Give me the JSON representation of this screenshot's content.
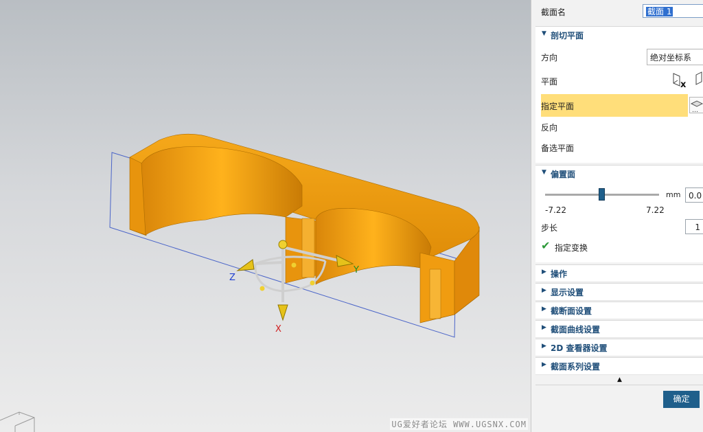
{
  "viewport": {
    "axis_labels": {
      "x": "X",
      "y": "Y",
      "z": "Z"
    }
  },
  "panel": {
    "section_name_label": "截面名",
    "section_name_value": "截面 1",
    "cut_plane": {
      "title": "剖切平面",
      "direction_label": "方向",
      "direction_value": "绝对坐标系",
      "plane_label": "平面",
      "specify_plane_label": "指定平面",
      "reverse_label": "反向",
      "alternate_plane_label": "备选平面"
    },
    "offset": {
      "title": "偏置面",
      "slider_min": "-7.22",
      "slider_max": "7.22",
      "slider_position": 0.5,
      "unit": "mm",
      "value": "0.0",
      "step_label": "步长",
      "step_value": "1",
      "specify_transform_label": "指定变换"
    },
    "collapsed_sections": [
      "操作",
      "显示设置",
      "截断面设置",
      "截面曲线设置",
      "2D 查看器设置",
      "截面系列设置"
    ],
    "ok_label": "确定"
  },
  "watermark": "UG爱好者论坛 WWW.UGSNX.COM",
  "colors": {
    "part_orange": "#f2a20c",
    "header_blue": "#1f4e79",
    "highlight_yellow": "#ffde7a",
    "ok_button": "#1f5f8b"
  }
}
